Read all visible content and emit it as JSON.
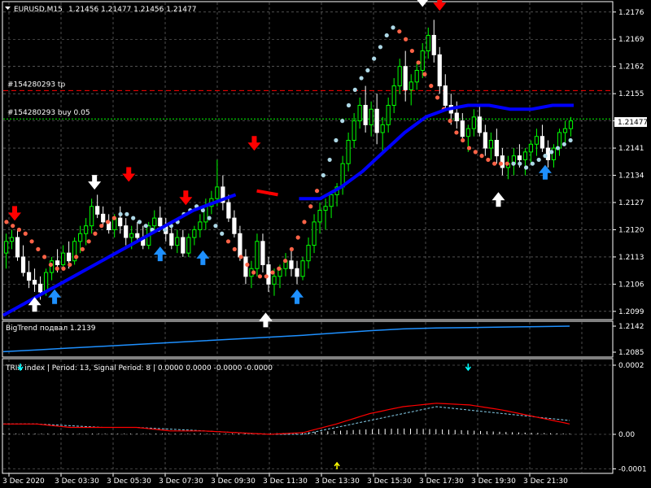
{
  "main_panel": {
    "header_symbol": "EURUSD,M15",
    "header_ohlc": "1.21456 1.21477 1.21456 1.21477",
    "y_ticks": [
      "1.2176",
      "1.2169",
      "1.2162",
      "1.2155",
      "1.2148",
      "1.2141",
      "1.2134",
      "1.2127",
      "1.2120",
      "1.2113",
      "1.2106",
      "1.2099"
    ],
    "y_tick_values": [
      1.2176,
      1.2169,
      1.2162,
      1.2155,
      1.2148,
      1.2141,
      1.2134,
      1.2127,
      1.212,
      1.2113,
      1.2106,
      1.2099
    ],
    "current_price_label": "1.21477",
    "current_price_value": 1.21477,
    "tp_label": "#154280293 tp",
    "tp_value": 1.21558,
    "buy_label": "#154280293 buy 0.05",
    "buy_value": 1.21485,
    "colors": {
      "bull": "#00ff00",
      "bear": "#ffffff",
      "trend_up": "#0000ff",
      "trend_down": "#ff0000",
      "dots_up": "#add8e6",
      "dots_down": "#ff6347",
      "arrow_up": "#1e90ff",
      "arrow_down": "#ff0000",
      "arrow_white": "#ffffff",
      "tp_line": "#ff0000",
      "buy_line": "#00ff00"
    }
  },
  "bigtrend_panel": {
    "label": "BigTrend подвал 1.2139",
    "y_ticks": [
      "1.2142",
      "1.2085"
    ],
    "y_tick_values": [
      1.2142,
      1.2085
    ],
    "color": "#1e90ff"
  },
  "trix_panel": {
    "label": "TRIX index | Period: 13, Signal Period: 8 | 0.0000 0.0000 -0.0000 -0.0000",
    "y_ticks": [
      "0.0002",
      "0.00",
      "-0.0001"
    ],
    "y_tick_values": [
      0.0002,
      0.0,
      -0.0001
    ],
    "colors": {
      "trix": "#ff0000",
      "signal": "#87ceeb",
      "hist": "#ffffff",
      "arrow_down": "#00ffff",
      "arrow_up": "#ffff00"
    }
  },
  "x_axis": {
    "labels": [
      "3 Dec 2020",
      "3 Dec 03:30",
      "3 Dec 05:30",
      "3 Dec 07:30",
      "3 Dec 09:30",
      "3 Dec 11:30",
      "3 Dec 13:30",
      "3 Dec 15:30",
      "3 Dec 17:30",
      "3 Dec 19:30",
      "3 Dec 21:30"
    ]
  },
  "chart_data": {
    "type": "line",
    "title": "EURUSD,M15",
    "ylim": [
      1.2095,
      1.2178
    ],
    "candles": [
      [
        1.2114,
        1.2119,
        1.211,
        1.2117
      ],
      [
        1.2117,
        1.212,
        1.2115,
        1.2118
      ],
      [
        1.2118,
        1.212,
        1.2112,
        1.2113
      ],
      [
        1.2113,
        1.2116,
        1.2108,
        1.2109
      ],
      [
        1.2109,
        1.2112,
        1.2105,
        1.2107
      ],
      [
        1.2107,
        1.211,
        1.2104,
        1.2106
      ],
      [
        1.2106,
        1.2108,
        1.2102,
        1.2104
      ],
      [
        1.2104,
        1.211,
        1.2103,
        1.2109
      ],
      [
        1.2109,
        1.2113,
        1.2107,
        1.2112
      ],
      [
        1.2112,
        1.2115,
        1.2109,
        1.2111
      ],
      [
        1.2111,
        1.2116,
        1.211,
        1.2114
      ],
      [
        1.2114,
        1.2117,
        1.211,
        1.2112
      ],
      [
        1.2112,
        1.2118,
        1.2111,
        1.2117
      ],
      [
        1.2117,
        1.2121,
        1.2114,
        1.2119
      ],
      [
        1.2119,
        1.2123,
        1.2116,
        1.2121
      ],
      [
        1.2121,
        1.2128,
        1.2119,
        1.2126
      ],
      [
        1.2126,
        1.2129,
        1.2123,
        1.2124
      ],
      [
        1.2124,
        1.2126,
        1.2121,
        1.2122
      ],
      [
        1.2122,
        1.2124,
        1.2119,
        1.212
      ],
      [
        1.212,
        1.2124,
        1.2118,
        1.2123
      ],
      [
        1.2123,
        1.2126,
        1.2119,
        1.2121
      ],
      [
        1.2121,
        1.2123,
        1.2116,
        1.2118
      ],
      [
        1.2118,
        1.2121,
        1.2115,
        1.2119
      ],
      [
        1.2119,
        1.2122,
        1.2117,
        1.2118
      ],
      [
        1.2118,
        1.2121,
        1.2115,
        1.2116
      ],
      [
        1.2116,
        1.2122,
        1.2115,
        1.2121
      ],
      [
        1.2121,
        1.2125,
        1.2119,
        1.2123
      ],
      [
        1.2123,
        1.2126,
        1.212,
        1.2121
      ],
      [
        1.2121,
        1.2123,
        1.2117,
        1.2119
      ],
      [
        1.2119,
        1.2121,
        1.2115,
        1.2116
      ],
      [
        1.2116,
        1.212,
        1.2114,
        1.2118
      ],
      [
        1.2118,
        1.212,
        1.2113,
        1.2114
      ],
      [
        1.2114,
        1.2119,
        1.2113,
        1.2118
      ],
      [
        1.2118,
        1.2121,
        1.2116,
        1.212
      ],
      [
        1.212,
        1.2124,
        1.2118,
        1.2122
      ],
      [
        1.2122,
        1.2128,
        1.212,
        1.2126
      ],
      [
        1.2126,
        1.213,
        1.2124,
        1.2128
      ],
      [
        1.2128,
        1.2138,
        1.2126,
        1.2131
      ],
      [
        1.2131,
        1.2134,
        1.2125,
        1.2127
      ],
      [
        1.2127,
        1.2129,
        1.2122,
        1.2123
      ],
      [
        1.2123,
        1.2125,
        1.2118,
        1.2119
      ],
      [
        1.2119,
        1.2121,
        1.2112,
        1.2113
      ],
      [
        1.2113,
        1.2115,
        1.2106,
        1.2108
      ],
      [
        1.2108,
        1.2112,
        1.2105,
        1.211
      ],
      [
        1.211,
        1.2119,
        1.2108,
        1.2117
      ],
      [
        1.2117,
        1.2119,
        1.2109,
        1.2111
      ],
      [
        1.2111,
        1.2113,
        1.2104,
        1.2106
      ],
      [
        1.2106,
        1.211,
        1.2103,
        1.2108
      ],
      [
        1.2108,
        1.2111,
        1.2105,
        1.211
      ],
      [
        1.211,
        1.2114,
        1.2108,
        1.2112
      ],
      [
        1.2112,
        1.2115,
        1.2108,
        1.211
      ],
      [
        1.211,
        1.2112,
        1.2106,
        1.2108
      ],
      [
        1.2108,
        1.2113,
        1.2107,
        1.2112
      ],
      [
        1.2112,
        1.2118,
        1.211,
        1.2116
      ],
      [
        1.2116,
        1.2124,
        1.2114,
        1.2122
      ],
      [
        1.2122,
        1.2127,
        1.2119,
        1.2125
      ],
      [
        1.2125,
        1.2128,
        1.212,
        1.2126
      ],
      [
        1.2126,
        1.213,
        1.2123,
        1.2129
      ],
      [
        1.2129,
        1.2132,
        1.2126,
        1.2131
      ],
      [
        1.2131,
        1.2139,
        1.2129,
        1.2137
      ],
      [
        1.2137,
        1.2145,
        1.2135,
        1.2143
      ],
      [
        1.2143,
        1.215,
        1.2141,
        1.2148
      ],
      [
        1.2148,
        1.2154,
        1.2146,
        1.2152
      ],
      [
        1.2152,
        1.2157,
        1.2145,
        1.2147
      ],
      [
        1.2147,
        1.2153,
        1.2144,
        1.2151
      ],
      [
        1.2151,
        1.2155,
        1.2142,
        1.2145
      ],
      [
        1.2145,
        1.2149,
        1.214,
        1.2147
      ],
      [
        1.2147,
        1.2154,
        1.2145,
        1.2152
      ],
      [
        1.2152,
        1.2159,
        1.215,
        1.2157
      ],
      [
        1.2157,
        1.2164,
        1.2155,
        1.2162
      ],
      [
        1.2162,
        1.2166,
        1.2153,
        1.2156
      ],
      [
        1.2156,
        1.216,
        1.2152,
        1.2158
      ],
      [
        1.2158,
        1.2163,
        1.2156,
        1.2161
      ],
      [
        1.2161,
        1.2168,
        1.2159,
        1.2166
      ],
      [
        1.2166,
        1.2172,
        1.2164,
        1.217
      ],
      [
        1.217,
        1.2174,
        1.2163,
        1.2165
      ],
      [
        1.2165,
        1.2167,
        1.2155,
        1.2157
      ],
      [
        1.2157,
        1.216,
        1.2151,
        1.2152
      ],
      [
        1.2152,
        1.2155,
        1.2147,
        1.215
      ],
      [
        1.215,
        1.2153,
        1.2146,
        1.2148
      ],
      [
        1.2148,
        1.215,
        1.2143,
        1.2144
      ],
      [
        1.2144,
        1.2147,
        1.214,
        1.2146
      ],
      [
        1.2146,
        1.2151,
        1.2144,
        1.2149
      ],
      [
        1.2149,
        1.2152,
        1.2144,
        1.2145
      ],
      [
        1.2145,
        1.2147,
        1.2139,
        1.2141
      ],
      [
        1.2141,
        1.2145,
        1.2138,
        1.2143
      ],
      [
        1.2143,
        1.2146,
        1.2137,
        1.2139
      ],
      [
        1.2139,
        1.2141,
        1.2134,
        1.2136
      ],
      [
        1.2136,
        1.2139,
        1.2133,
        1.2137
      ],
      [
        1.2137,
        1.2141,
        1.2134,
        1.2139
      ],
      [
        1.2139,
        1.2142,
        1.2136,
        1.2138
      ],
      [
        1.2138,
        1.2141,
        1.2134,
        1.214
      ],
      [
        1.214,
        1.2143,
        1.2137,
        1.2142
      ],
      [
        1.2142,
        1.2146,
        1.2139,
        1.2144
      ],
      [
        1.2144,
        1.2147,
        1.214,
        1.2141
      ],
      [
        1.2141,
        1.2143,
        1.2136,
        1.2138
      ],
      [
        1.2138,
        1.2142,
        1.2136,
        1.2141
      ],
      [
        1.2141,
        1.2146,
        1.2139,
        1.2145
      ],
      [
        1.2145,
        1.2148,
        1.2142,
        1.2146
      ],
      [
        1.2146,
        1.2149,
        1.2144,
        1.2148
      ]
    ],
    "big_trend": [
      1.2098,
      1.2101,
      1.2104,
      1.2107,
      1.211,
      1.2113,
      1.2116,
      1.2119,
      1.2122,
      1.2125,
      1.2127,
      1.2129,
      1.213,
      1.2129,
      1.2128,
      1.2128,
      1.2131,
      1.2135,
      1.214,
      1.2145,
      1.2149,
      1.2151,
      1.2152,
      1.2152,
      1.2151,
      1.2151,
      1.2152,
      1.2152
    ],
    "big_trend_down_segment": [
      0.41,
      0.51
    ],
    "trailing_dots": [
      1.2122,
      1.2121,
      1.212,
      1.2119,
      1.2117,
      1.2115,
      1.2113,
      1.2111,
      1.211,
      1.211,
      1.2111,
      1.2113,
      1.2115,
      1.2117,
      1.2119,
      1.2121,
      1.2122,
      1.2123,
      1.2124,
      1.2124,
      1.2123,
      1.2122,
      1.2121,
      1.212,
      1.212,
      1.212,
      1.2121,
      1.2122,
      1.2124,
      1.2125,
      1.2126,
      1.2125,
      1.2123,
      1.2121,
      1.2119,
      1.2117,
      1.2115,
      1.2113,
      1.2111,
      1.2109,
      1.2108,
      1.2108,
      1.2109,
      1.211,
      1.2112,
      1.2115,
      1.2118,
      1.2122,
      1.2126,
      1.213,
      1.2134,
      1.2138,
      1.2143,
      1.2148,
      1.2152,
      1.2156,
      1.2159,
      1.2161,
      1.2164,
      1.2167,
      1.217,
      1.2172,
      1.2171,
      1.2169,
      1.2166,
      1.2163,
      1.216,
      1.2157,
      1.2154,
      1.2151,
      1.2148,
      1.2145,
      1.2143,
      1.2141,
      1.214,
      1.2139,
      1.2138,
      1.2137,
      1.2137,
      1.2137,
      1.2137,
      1.2137,
      1.2136,
      1.2137,
      1.2138,
      1.2139,
      1.214,
      1.2141,
      1.2142,
      1.2143
    ],
    "dots_flip_index": [
      18,
      35,
      50,
      62,
      80
    ],
    "arrows": [
      {
        "t": 0.02,
        "dir": "down",
        "color": "red",
        "price": 1.2124
      },
      {
        "t": 0.055,
        "dir": "up",
        "color": "white",
        "price": 1.2101
      },
      {
        "t": 0.09,
        "dir": "up",
        "color": "blue",
        "price": 1.2103
      },
      {
        "t": 0.16,
        "dir": "down",
        "color": "white",
        "price": 1.2132
      },
      {
        "t": 0.22,
        "dir": "down",
        "color": "red",
        "price": 1.2134
      },
      {
        "t": 0.275,
        "dir": "up",
        "color": "blue",
        "price": 1.2114
      },
      {
        "t": 0.32,
        "dir": "down",
        "color": "red",
        "price": 1.2128
      },
      {
        "t": 0.35,
        "dir": "up",
        "color": "blue",
        "price": 1.2113
      },
      {
        "t": 0.44,
        "dir": "down",
        "color": "red",
        "price": 1.2142
      },
      {
        "t": 0.46,
        "dir": "up",
        "color": "white",
        "price": 1.2097
      },
      {
        "t": 0.515,
        "dir": "up",
        "color": "blue",
        "price": 1.2103
      },
      {
        "t": 0.735,
        "dir": "down",
        "color": "white",
        "price": 1.2179
      },
      {
        "t": 0.765,
        "dir": "down",
        "color": "red",
        "price": 1.2178
      },
      {
        "t": 0.868,
        "dir": "up",
        "color": "white",
        "price": 1.2128
      },
      {
        "t": 0.95,
        "dir": "up",
        "color": "blue",
        "price": 1.2135
      }
    ],
    "bigtrend_series": [
      1.2086,
      1.209,
      1.2094,
      1.2098,
      1.2102,
      1.2106,
      1.211,
      1.2114,
      1.2118,
      1.2122,
      1.2127,
      1.2132,
      1.2136,
      1.2138,
      1.2139,
      1.214,
      1.2141,
      1.2142
    ],
    "trix_series": [
      3e-05,
      3e-05,
      2e-05,
      2e-05,
      2e-05,
      1e-05,
      1e-05,
      5e-06,
      0.0,
      5e-06,
      3e-05,
      6e-05,
      8e-05,
      9e-05,
      8.5e-05,
      7e-05,
      5e-05,
      3e-05
    ],
    "signal_series": [
      3e-05,
      3e-05,
      2.5e-05,
      2e-05,
      2e-05,
      1.5e-05,
      1e-05,
      5e-06,
      0.0,
      0.0,
      2e-05,
      4e-05,
      6e-05,
      8e-05,
      7e-05,
      6e-05,
      5e-05,
      4e-05
    ],
    "trix_hist_series": [
      2e-06,
      2e-06,
      2e-06,
      2e-06,
      2e-06,
      2e-06,
      2e-06,
      2e-06,
      3e-06,
      5e-06,
      1e-05,
      1.5e-05,
      1.7e-05,
      1.5e-05,
      1.1e-05,
      7e-06,
      4e-06,
      2e-06
    ],
    "trix_arrows": [
      {
        "t": 0.03,
        "dir": "down",
        "color": "cyan"
      },
      {
        "t": 0.585,
        "dir": "up",
        "color": "yellow"
      },
      {
        "t": 0.815,
        "dir": "down",
        "color": "cyan"
      }
    ]
  }
}
